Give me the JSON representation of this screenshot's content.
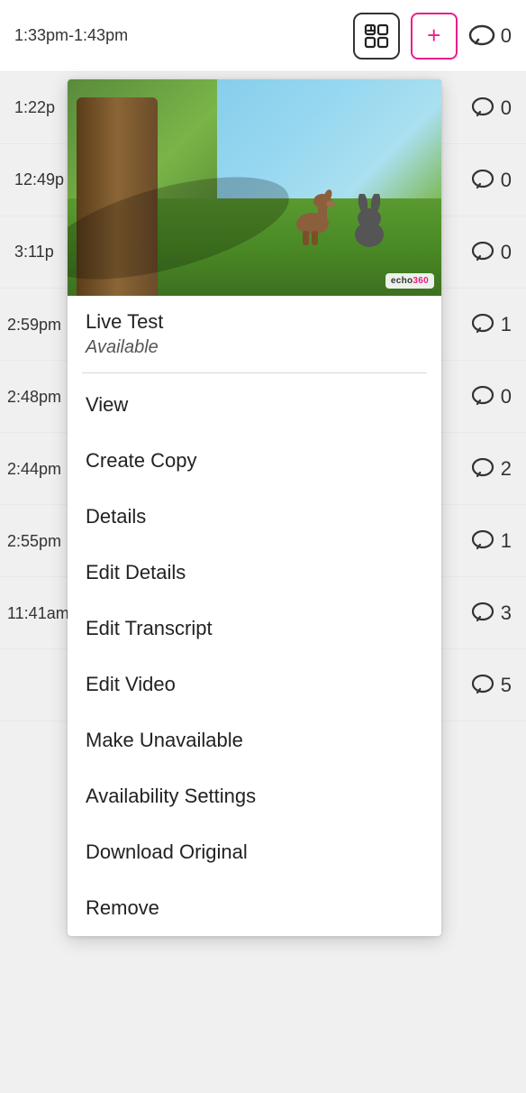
{
  "header": {
    "time_range": "1:33pm-1:43pm",
    "comment_count": "0",
    "icons": {
      "grid_icon": "⊞",
      "plus_icon": "+",
      "comment_icon": "💬"
    }
  },
  "background_rows": [
    {
      "time": "1:22p",
      "comment_count": "0"
    },
    {
      "time": "12:49p",
      "comment_count": "0"
    },
    {
      "time": "3:11p",
      "comment_count": "0"
    },
    {
      "time": "2:59pm",
      "comment_count": "1"
    },
    {
      "time": "2:48pm",
      "comment_count": "0"
    },
    {
      "time": "2:44pm",
      "comment_count": "2"
    },
    {
      "time": "2:55pm",
      "comment_count": "1"
    },
    {
      "time": "11:41am",
      "comment_count": "3"
    },
    {
      "time": "",
      "comment_count": "5"
    }
  ],
  "dropdown": {
    "thumbnail_alt": "Echo360 video thumbnail with animated animals",
    "echo360_label": "echo360",
    "title": "Live Test",
    "status": "Available",
    "menu_items": [
      {
        "label": "View",
        "id": "view"
      },
      {
        "label": "Create Copy",
        "id": "create-copy"
      },
      {
        "label": "Details",
        "id": "details"
      },
      {
        "label": "Edit Details",
        "id": "edit-details"
      },
      {
        "label": "Edit Transcript",
        "id": "edit-transcript"
      },
      {
        "label": "Edit Video",
        "id": "edit-video"
      },
      {
        "label": "Make Unavailable",
        "id": "make-unavailable"
      },
      {
        "label": "Availability Settings",
        "id": "availability-settings"
      },
      {
        "label": "Download Original",
        "id": "download-original"
      },
      {
        "label": "Remove",
        "id": "remove"
      }
    ]
  }
}
